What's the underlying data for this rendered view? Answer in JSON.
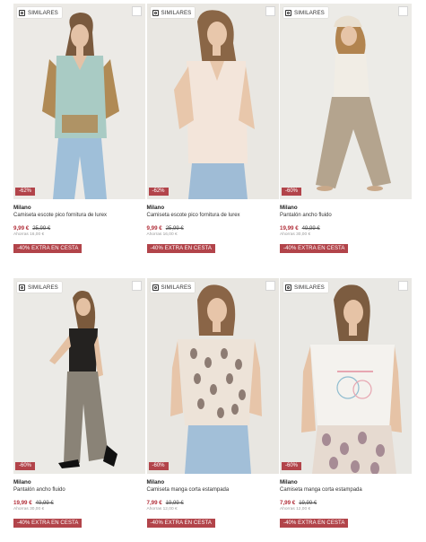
{
  "ui": {
    "similar_label": "SIMILARES",
    "extra_label": "-40% EXTRA EN CESTA"
  },
  "colors": {
    "accent": "#b2444a",
    "price": "#b12f3a",
    "photo_bg": "#ececea"
  },
  "products": [
    {
      "brand": "Milano",
      "name": "Camiseta escote pico fornitura de lurex",
      "price": "9,99 €",
      "old_price": "25,99 €",
      "savings": "Ahorras 16,00 €",
      "discount": "-62%",
      "photo": "woman-mint-v-neck-tee-tan-cardigan-jeans"
    },
    {
      "brand": "Milano",
      "name": "Camiseta escote pico fornitura de lurex",
      "price": "9,99 €",
      "old_price": "25,99 €",
      "savings": "Ahorras 16,00 €",
      "discount": "-62%",
      "photo": "woman-cream-v-neck-tee-jeans"
    },
    {
      "brand": "Milano",
      "name": "Pantalón ancho fluido",
      "price": "19,99 €",
      "old_price": "49,99 €",
      "savings": "Ahorras 30,00 €",
      "discount": "-60%",
      "photo": "woman-cap-knit-top-wide-beige-trousers"
    },
    {
      "brand": "Milano",
      "name": "Pantalón ancho fluido",
      "price": "19,99 €",
      "old_price": "49,99 €",
      "savings": "Ahorras 30,00 €",
      "discount": "-60%",
      "photo": "woman-black-top-wide-grey-trousers"
    },
    {
      "brand": "Milano",
      "name": "Camiseta manga corta estampada",
      "price": "7,99 €",
      "old_price": "19,99 €",
      "savings": "Ahorras 12,00 €",
      "discount": "-60%",
      "photo": "woman-printed-tee-jeans"
    },
    {
      "brand": "Milano",
      "name": "Camiseta manga corta estampada",
      "price": "7,99 €",
      "old_price": "19,99 €",
      "savings": "Ahorras 12,00 €",
      "discount": "-60%",
      "photo": "woman-white-graphic-tee-printed-skirt"
    }
  ]
}
